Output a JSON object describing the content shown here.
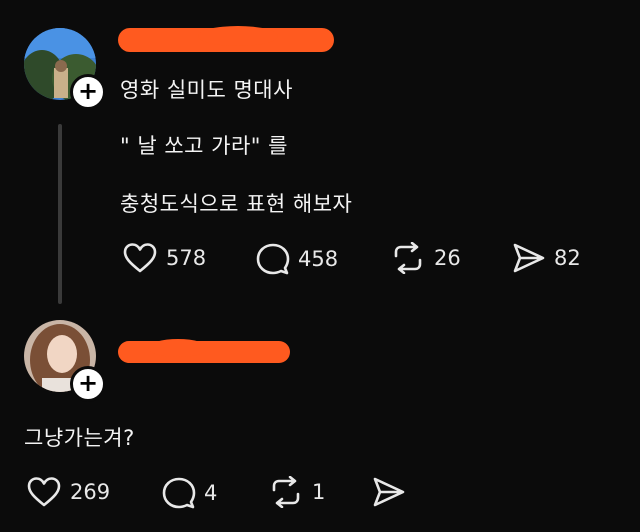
{
  "post": {
    "lines": [
      "영화 실미도 명대사",
      "\" 날 쏘고 가라\" 를",
      "충청도식으로 표현 해보자"
    ],
    "stats": {
      "likes": "578",
      "replies": "458",
      "reposts": "26",
      "shares": "82"
    }
  },
  "reply": {
    "text": "그냥가는겨?",
    "stats": {
      "likes": "269",
      "replies": "4",
      "reposts": "1"
    }
  },
  "colors": {
    "redaction": "#ff5a1f",
    "background": "#0b0b0b"
  },
  "icons": [
    "plus-icon",
    "heart-icon",
    "comment-icon",
    "repost-icon",
    "share-icon"
  ]
}
